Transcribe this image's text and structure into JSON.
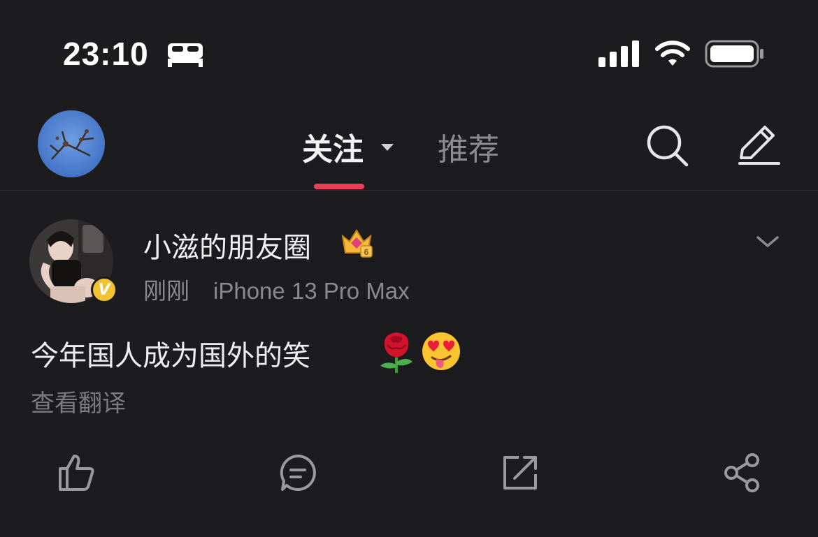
{
  "status_bar": {
    "time": "23:10",
    "icons": [
      "bed-icon",
      "cellular-signal-icon",
      "wifi-icon",
      "battery-icon"
    ]
  },
  "top_nav": {
    "tabs": [
      {
        "label": "关注",
        "active": true,
        "has_dropdown": true
      },
      {
        "label": "推荐",
        "active": false
      }
    ],
    "accent_color": "#e8405a",
    "icons": [
      "search-icon",
      "compose-icon"
    ]
  },
  "post": {
    "username": "小滋的朋友圈",
    "member_badge": "crown-icon",
    "time": "刚刚",
    "device": "iPhone 13 Pro Max",
    "text": "今年国人成为国外的笑",
    "emojis": [
      "rose-icon",
      "heart-eyes-tongue-icon"
    ],
    "translate_label": "查看翻译",
    "verified": true,
    "actions": [
      "like-icon",
      "comment-icon",
      "repost-icon",
      "share-icon"
    ]
  },
  "colors": {
    "background": "#1c1c1e",
    "primary_text": "#f0f0f2",
    "secondary_text": "#8a8a8e",
    "verified_badge": "#f2c230"
  }
}
